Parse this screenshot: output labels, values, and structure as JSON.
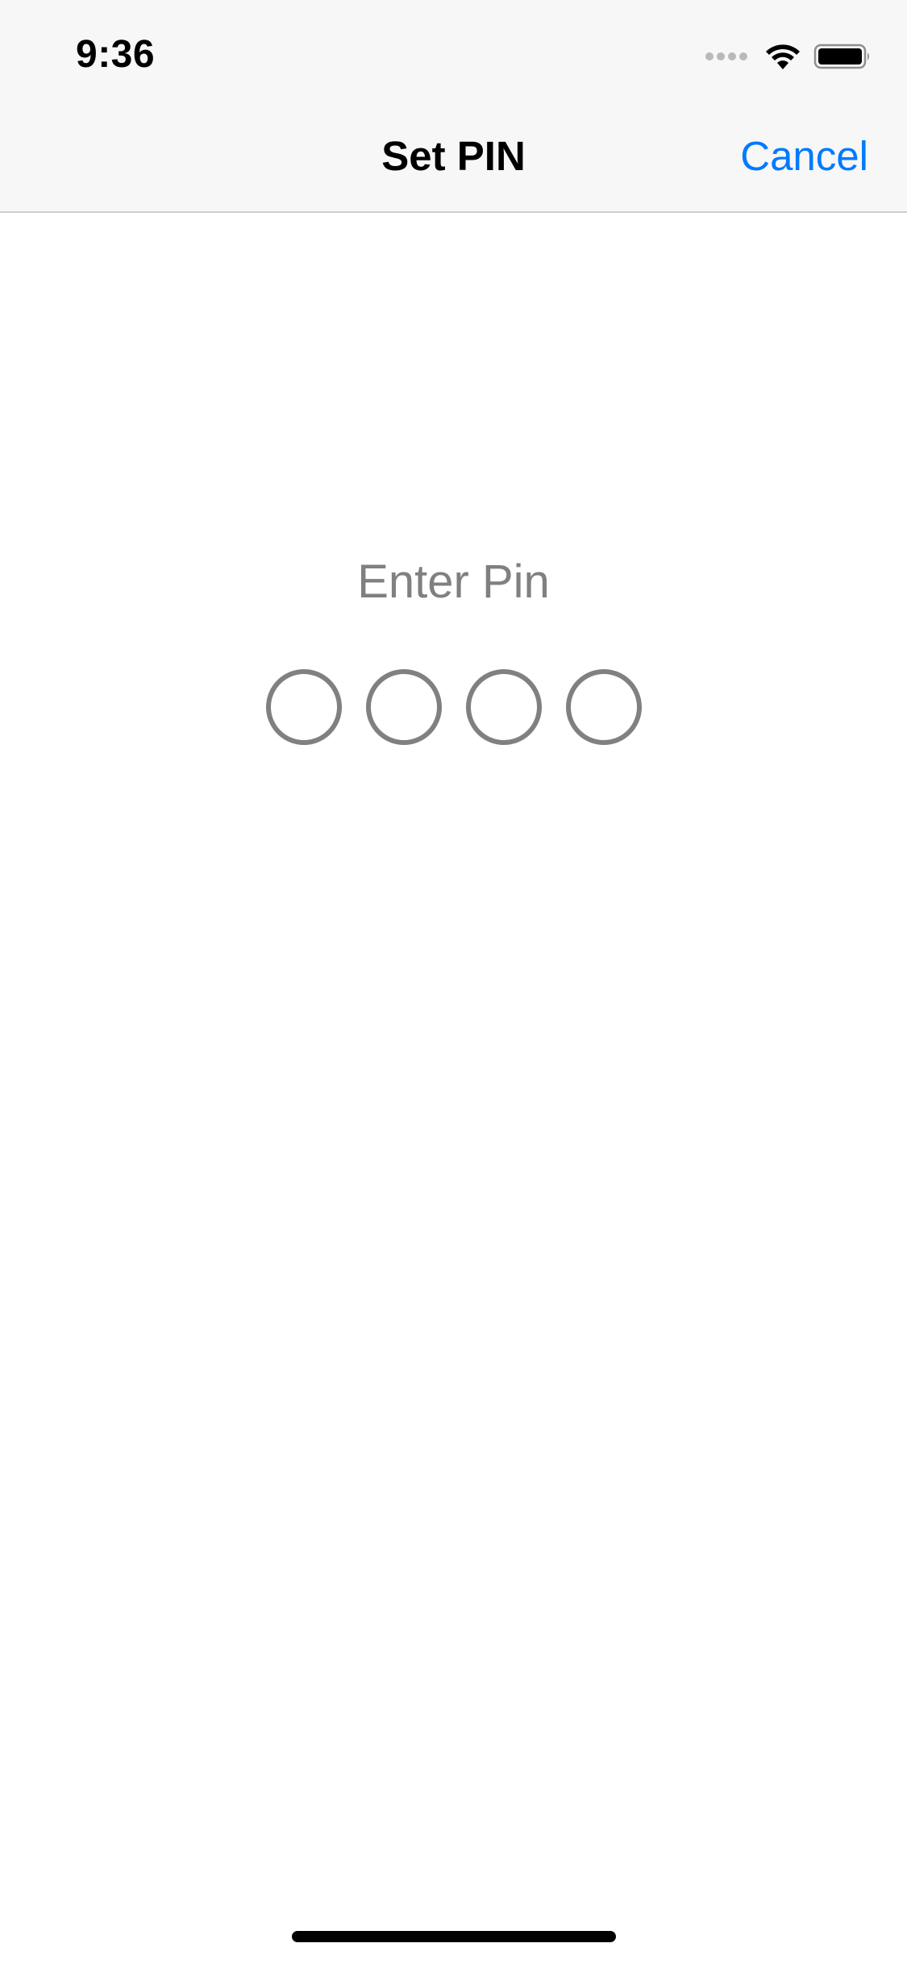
{
  "status_bar": {
    "time": "9:36",
    "icons": [
      "signal-icon",
      "wifi-icon",
      "battery-icon"
    ]
  },
  "nav_bar": {
    "title": "Set PIN",
    "cancel_label": "Cancel"
  },
  "pin_entry": {
    "prompt": "Enter Pin",
    "digit_count": 4,
    "filled": 0
  },
  "colors": {
    "accent": "#007aff",
    "nav_background": "#f7f7f7",
    "prompt_gray": "#808080",
    "background": "#ffffff"
  }
}
